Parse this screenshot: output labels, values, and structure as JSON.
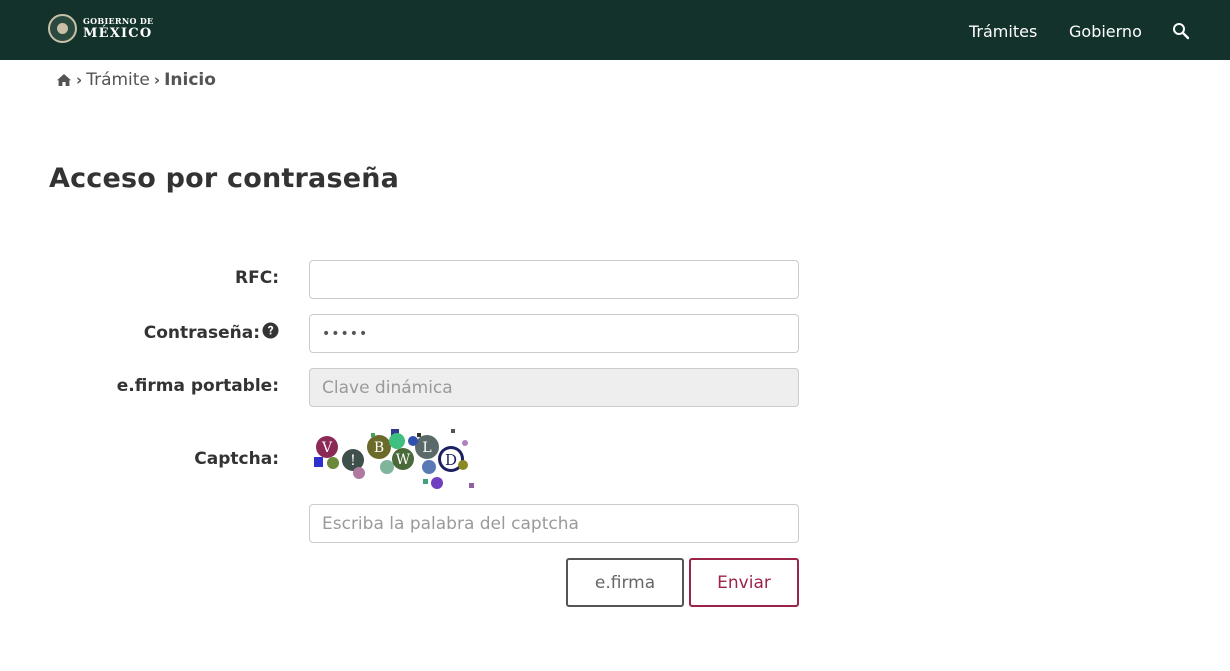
{
  "header": {
    "logo_top": "GOBIERNO DE",
    "logo_bottom": "MÉXICO",
    "nav": [
      "Trámites",
      "Gobierno"
    ],
    "search_icon": "search-icon",
    "background": "#13322b"
  },
  "breadcrumb": {
    "home_icon": "home-icon",
    "separator": "›",
    "items": [
      "Trámite",
      "Inicio"
    ]
  },
  "page": {
    "title": "Acceso por contraseña"
  },
  "form": {
    "rfc_label": "RFC:",
    "rfc_value": "",
    "password_label": "Contraseña:",
    "password_value": "•••••",
    "efirma_label": "e.firma portable:",
    "efirma_placeholder": "Clave dinámica",
    "captcha_label": "Captcha:",
    "captcha_placeholder": "Escriba la palabra del captcha"
  },
  "buttons": {
    "efirma": "e.firma",
    "enviar": "Enviar"
  },
  "colors": {
    "accent": "#9d2449",
    "header": "#13322b"
  }
}
